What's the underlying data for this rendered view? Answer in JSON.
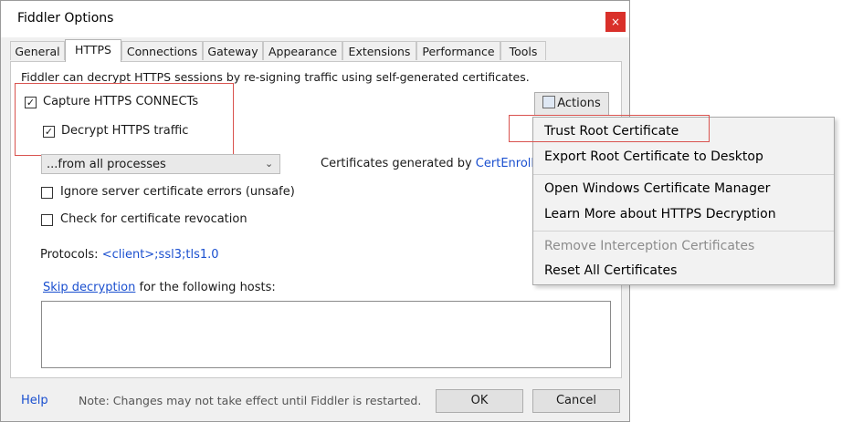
{
  "window": {
    "title": "Fiddler Options",
    "close_glyph": "×"
  },
  "tabs": [
    {
      "label": "General"
    },
    {
      "label": "HTTPS"
    },
    {
      "label": "Connections"
    },
    {
      "label": "Gateway"
    },
    {
      "label": "Appearance"
    },
    {
      "label": "Extensions"
    },
    {
      "label": "Performance"
    },
    {
      "label": "Tools"
    }
  ],
  "active_tab": "HTTPS",
  "https": {
    "intro": "Fiddler can decrypt HTTPS sessions by re-signing traffic using self-generated certificates.",
    "capture_label": "Capture HTTPS CONNECTs",
    "capture_checked": true,
    "decrypt_label": "Decrypt HTTPS traffic",
    "decrypt_checked": true,
    "process_filter_value": "...from all processes",
    "cert_generated_prefix": "Certificates generated by",
    "cert_generator_link": "CertEnroll e",
    "actions_button": "Actions",
    "ignore_errors_label": "Ignore server certificate errors (unsafe)",
    "ignore_errors_checked": false,
    "revocation_label": "Check for certificate revocation",
    "revocation_checked": false,
    "protocols_label": "Protocols:",
    "protocols_value": "<client>;ssl3;tls1.0",
    "skip_link": "Skip decryption",
    "skip_suffix": "for the following hosts:",
    "skip_hosts_value": ""
  },
  "footer": {
    "help": "Help",
    "note": "Note: Changes may not take effect until Fiddler is restarted.",
    "ok": "OK",
    "cancel": "Cancel"
  },
  "actions_menu": {
    "items": [
      {
        "label": "Trust Root Certificate",
        "enabled": true
      },
      {
        "label": "Export Root Certificate to Desktop",
        "enabled": true
      },
      {
        "label": "Open Windows Certificate Manager",
        "enabled": true
      },
      {
        "label": "Learn More about HTTPS Decryption",
        "enabled": true
      },
      {
        "label": "Remove Interception Certificates",
        "enabled": false
      },
      {
        "label": "Reset All Certificates",
        "enabled": true
      }
    ]
  },
  "colors": {
    "close_button": "#d9302a",
    "link": "#1a4fcf",
    "highlight_box": "#d9534f"
  }
}
